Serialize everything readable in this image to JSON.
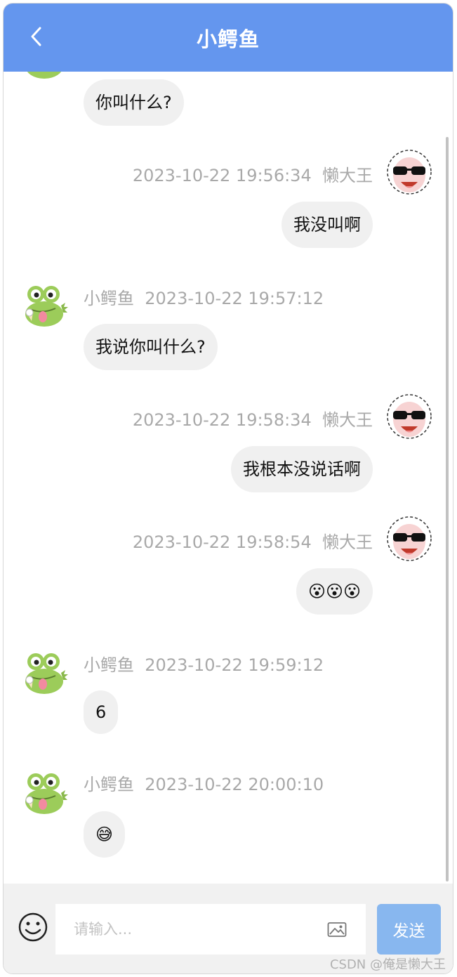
{
  "header": {
    "title": "小鳄鱼"
  },
  "messages": [
    {
      "sender": "小鳄鱼",
      "side": "left",
      "time": "",
      "text": "你叫什么?"
    },
    {
      "sender": "懒大王",
      "side": "right",
      "time": "2023-10-22 19:56:34",
      "text": "我没叫啊"
    },
    {
      "sender": "小鳄鱼",
      "side": "left",
      "time": "2023-10-22 19:57:12",
      "text": "我说你叫什么?"
    },
    {
      "sender": "懒大王",
      "side": "right",
      "time": "2023-10-22 19:58:34",
      "text": "我根本没说话啊"
    },
    {
      "sender": "懒大王",
      "side": "right",
      "time": "2023-10-22 19:58:54",
      "text": "😮😮😮"
    },
    {
      "sender": "小鳄鱼",
      "side": "left",
      "time": "2023-10-22 19:59:12",
      "text": "6"
    },
    {
      "sender": "小鳄鱼",
      "side": "left",
      "time": "2023-10-22 20:00:10",
      "text": "😅"
    }
  ],
  "input": {
    "placeholder": "请输入...",
    "value": ""
  },
  "send_label": "发送",
  "icons": {
    "back": "chevron-left-icon",
    "emoji": "smile-icon",
    "image": "image-icon"
  },
  "colors": {
    "header": "#6496ee",
    "send_button": "#88b7ef",
    "bubble": "#f0f0f0"
  },
  "watermark": "CSDN @俺是懒大王"
}
